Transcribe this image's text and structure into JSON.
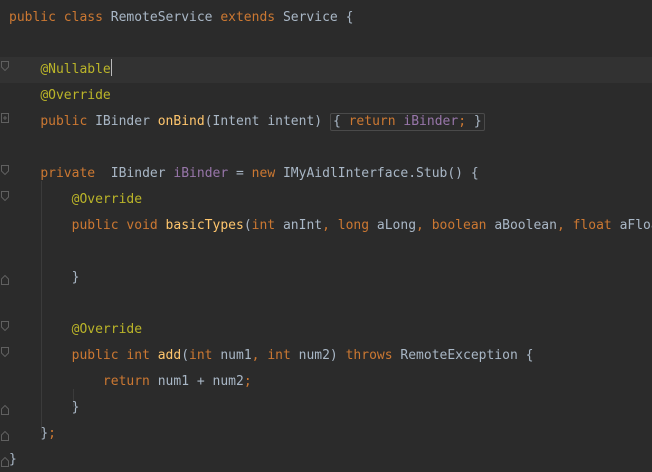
{
  "editor": {
    "theme": "darcula",
    "colors": {
      "background": "#2b2b2b",
      "current_line": "#323232",
      "keyword": "#cc7832",
      "annotation": "#bbb529",
      "method": "#ffc66d",
      "field": "#9876aa",
      "text": "#a9b7c6"
    },
    "lines": [
      {
        "tokens": [
          {
            "t": "public class ",
            "c": "kw"
          },
          {
            "t": "RemoteService ",
            "c": "plain"
          },
          {
            "t": "extends ",
            "c": "kw"
          },
          {
            "t": "Service {",
            "c": "plain"
          }
        ]
      },
      {
        "tokens": []
      },
      {
        "tokens": [
          {
            "t": "    "
          },
          {
            "t": "@Nullable",
            "c": "ann"
          }
        ],
        "current": true,
        "caret": true
      },
      {
        "tokens": [
          {
            "t": "    "
          },
          {
            "t": "@Override",
            "c": "ann"
          }
        ]
      },
      {
        "tokens": [
          {
            "t": "    "
          },
          {
            "t": "public ",
            "c": "kw"
          },
          {
            "t": "IBinder ",
            "c": "plain"
          },
          {
            "t": "onBind",
            "c": "fn"
          },
          {
            "t": "(Intent intent) ",
            "c": "plain"
          },
          {
            "fold": [
              {
                "t": "{ ",
                "c": "plain"
              },
              {
                "t": "return ",
                "c": "kw"
              },
              {
                "t": "iBinder",
                "c": "fld"
              },
              {
                "t": "; ",
                "c": "kw"
              },
              {
                "t": "}",
                "c": "plain"
              }
            ]
          }
        ]
      },
      {
        "tokens": []
      },
      {
        "tokens": [
          {
            "t": "    "
          },
          {
            "t": "private  ",
            "c": "kw"
          },
          {
            "t": "IBinder ",
            "c": "plain"
          },
          {
            "t": "iBinder ",
            "c": "fld"
          },
          {
            "t": "= ",
            "c": "plain"
          },
          {
            "t": "new ",
            "c": "kw"
          },
          {
            "t": "IMyAidlInterface.Stub() {",
            "c": "plain"
          }
        ]
      },
      {
        "tokens": [
          {
            "t": "        "
          },
          {
            "t": "@Override",
            "c": "ann"
          }
        ]
      },
      {
        "tokens": [
          {
            "t": "        "
          },
          {
            "t": "public void ",
            "c": "kw"
          },
          {
            "t": "basicTypes",
            "c": "fn"
          },
          {
            "t": "(",
            "c": "plain"
          },
          {
            "t": "int ",
            "c": "kw"
          },
          {
            "t": "anInt",
            "c": "plain"
          },
          {
            "t": ", ",
            "c": "kw"
          },
          {
            "t": "long ",
            "c": "kw"
          },
          {
            "t": "aLong",
            "c": "plain"
          },
          {
            "t": ", ",
            "c": "kw"
          },
          {
            "t": "boolean ",
            "c": "kw"
          },
          {
            "t": "aBoolean",
            "c": "plain"
          },
          {
            "t": ", ",
            "c": "kw"
          },
          {
            "t": "float ",
            "c": "kw"
          },
          {
            "t": "aFloat",
            "c": "plain"
          }
        ]
      },
      {
        "tokens": []
      },
      {
        "tokens": [
          {
            "t": "        "
          },
          {
            "t": "}",
            "c": "plain"
          }
        ]
      },
      {
        "tokens": []
      },
      {
        "tokens": [
          {
            "t": "        "
          },
          {
            "t": "@Override",
            "c": "ann"
          }
        ]
      },
      {
        "tokens": [
          {
            "t": "        "
          },
          {
            "t": "public int ",
            "c": "kw"
          },
          {
            "t": "add",
            "c": "fn"
          },
          {
            "t": "(",
            "c": "plain"
          },
          {
            "t": "int ",
            "c": "kw"
          },
          {
            "t": "num1",
            "c": "plain"
          },
          {
            "t": ", ",
            "c": "kw"
          },
          {
            "t": "int ",
            "c": "kw"
          },
          {
            "t": "num2) ",
            "c": "plain"
          },
          {
            "t": "throws ",
            "c": "kw"
          },
          {
            "t": "RemoteException {",
            "c": "plain"
          }
        ]
      },
      {
        "tokens": [
          {
            "t": "            "
          },
          {
            "t": "return ",
            "c": "kw"
          },
          {
            "t": "num1 + num2",
            "c": "plain"
          },
          {
            "t": ";",
            "c": "kw"
          }
        ]
      },
      {
        "tokens": [
          {
            "t": "        "
          },
          {
            "t": "}",
            "c": "plain"
          }
        ]
      },
      {
        "tokens": [
          {
            "t": "    "
          },
          {
            "t": "}",
            "c": "plain"
          },
          {
            "t": ";",
            "c": "kw"
          }
        ]
      },
      {
        "tokens": [
          {
            "t": "}",
            "c": "plain"
          }
        ]
      }
    ]
  }
}
